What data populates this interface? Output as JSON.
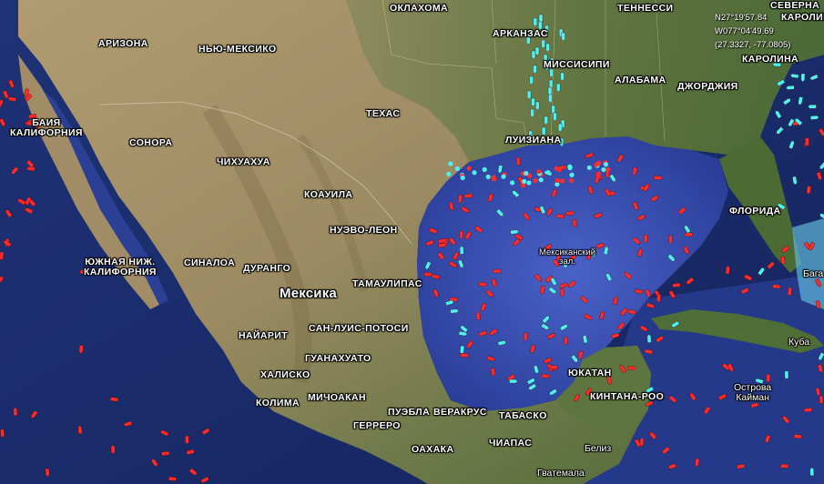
{
  "map": {
    "labels": {
      "oklahoma": "ОКЛАХОМА",
      "tennessee": "ТЕННЕССИ",
      "north_carolina_partial": "СЕВЕРНА",
      "carolina_partial": "КАРОЛИН",
      "arizona": "АРИЗОНА",
      "new_mexico": "НЬЮ-МЕКСИКО",
      "arkansas": "АРКАНЗАС",
      "mississippi": "МИССИСИПИ",
      "alabama": "АЛАБАМА",
      "georgia": "ДЖОРДЖИЯ",
      "south_carolina": "КАРОЛИНА",
      "texas": "ТЕХАС",
      "baja_california": "БАИЯ\nКАЛИФОРНИЯ",
      "sonora": "СОНОРА",
      "chihuahua": "ЧИХУАХУА",
      "louisiana": "ЛУИЗИАНА",
      "coahuila": "КОАУИЛА",
      "nuevo_leon": "НУЭВО-ЛЕОН",
      "florida": "ФЛОРИДА",
      "baja_california_sur": "ЮЖНАЯ НИЖ.\nКАЛИФОРНИЯ",
      "sinaloa": "СИНАЛОА",
      "durango": "ДУРАНГО",
      "mexico": "Мексика",
      "tamaulipas": "ТАМАУЛИПАС",
      "gulf_of_mexico": "Мексиканский\nзал.",
      "bahamas_partial": "Бага",
      "nayarit": "НАЙАРИТ",
      "san_luis_potosi": "САН-ЛУИС-ПОТОСИ",
      "cuba": "Куба",
      "guanajuato": "ГУАНАХУАТО",
      "jalisco": "ХАЛИСКО",
      "yucatan": "ЮКАТАН",
      "colima": "КОЛИМА",
      "michoacan": "МИЧОАКАН",
      "quintana_roo": "КИНТАНА-РОО",
      "cayman": "Острова\nКайман",
      "puebla": "ПУЭБЛА",
      "veracruz": "ВЕРАКРУС",
      "tabasco": "ТАБАСКО",
      "guerrero": "ГЕРРЕРО",
      "oaxaca": "ОАХАКА",
      "chiapas": "ЧИАПАС",
      "belize": "Белиз",
      "guatemala": "Гватемала"
    },
    "cursor_readout": {
      "lat": "N27°19'57.84",
      "lon": "W077°04'49.69",
      "decimal": "(27.3327, -77.0805)"
    },
    "colors": {
      "ocean_deep": "#1c2d6e",
      "ocean_gulf": "#3448a8",
      "land_desert": "#a8946c",
      "land_green": "#4f6b35",
      "cargo_ship": "#ff2a2a",
      "tanker_other": "#4ff0ee"
    },
    "legend_note": "vessel markers: red = cargo/tanker, cyan = other"
  }
}
